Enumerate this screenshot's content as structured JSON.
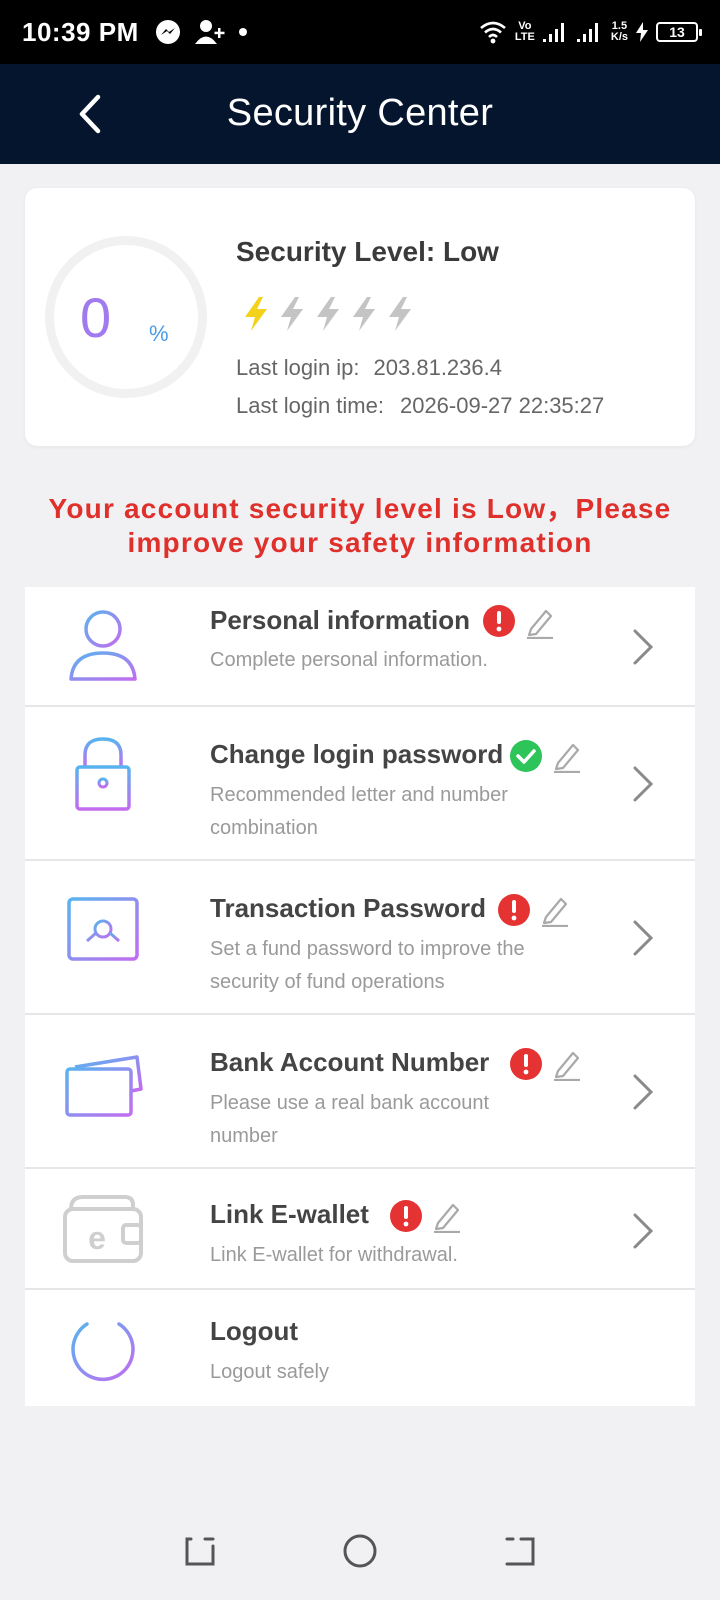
{
  "status_bar": {
    "time": "10:39 PM",
    "network_top": "Vo",
    "network_bottom": "LTE",
    "speed_top": "1.5",
    "speed_bottom": "K/s",
    "battery": "13"
  },
  "header": {
    "title": "Security Center",
    "back_icon": "chevron-left-icon"
  },
  "security": {
    "percent": "0",
    "percent_sign": "%",
    "level_title": "Security Level: Low",
    "level_value": 1,
    "level_max": 5,
    "active_color": "#f2d21b",
    "inactive_color": "#c4c4c4",
    "ip_label": "Last login ip:",
    "ip_value": "203.81.236.4",
    "time_label": "Last login time:",
    "time_value": "2026-09-27 22:35:27"
  },
  "warning": {
    "line1": "Your account security level is Low，Please",
    "line2": "improve your safety information"
  },
  "items": [
    {
      "title": "Personal information",
      "desc": "Complete personal information.",
      "status": "error",
      "icon": "user-icon"
    },
    {
      "title": "Change login password",
      "desc": "Recommended letter and number combination",
      "status": "ok",
      "icon": "lock-icon"
    },
    {
      "title": "Transaction Password",
      "desc": "Set a fund password to improve the security of fund operations",
      "status": "error",
      "icon": "safe-icon"
    },
    {
      "title": "Bank Account Number",
      "desc": "Please use a real bank account number",
      "status": "error",
      "icon": "bank-card-icon"
    },
    {
      "title": "Link E-wallet",
      "desc": "Link E-wallet for withdrawal.",
      "status": "error",
      "icon": "wallet-icon"
    },
    {
      "title": "Logout",
      "desc": "Logout safely",
      "icon": "power-icon"
    }
  ],
  "colors": {
    "header_bg": "#04152d",
    "error": "#e53232",
    "ok": "#2dc55a",
    "warning_text": "#e0302c",
    "icon_gradient_start": "#58b4ef",
    "icon_gradient_end": "#c36cf0"
  }
}
